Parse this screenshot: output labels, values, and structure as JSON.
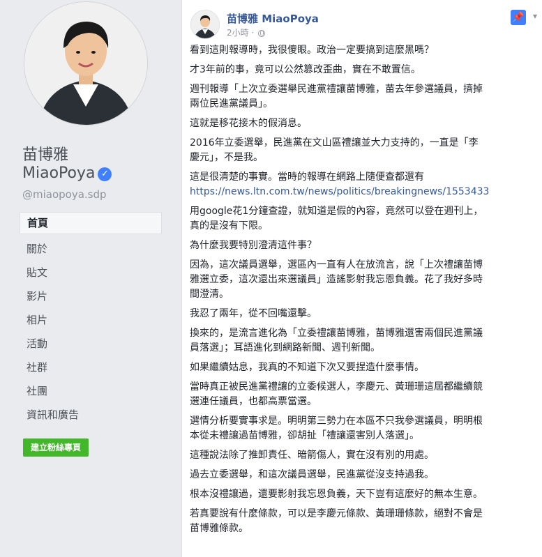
{
  "profile": {
    "name_line1": "苗博雅",
    "name_line2": "MiaoPoya",
    "handle": "@miaopoya.sdp"
  },
  "nav": {
    "items": [
      {
        "label": "首頁"
      },
      {
        "label": "關於"
      },
      {
        "label": "貼文"
      },
      {
        "label": "影片"
      },
      {
        "label": "相片"
      },
      {
        "label": "活動"
      },
      {
        "label": "社群"
      },
      {
        "label": "社團"
      },
      {
        "label": "資訊和廣告"
      }
    ]
  },
  "create_button": "建立粉絲專頁",
  "post": {
    "author": "苗博雅 MiaoPoya",
    "time": "2小時 · ",
    "paragraphs": [
      {
        "text": "看到這則報導時，我很傻眼。政治一定要搞到這麼黑嗎？"
      },
      {
        "text": "才3年前的事，竟可以公然篡改歪曲，實在不敢置信。"
      },
      {
        "text": "週刊報導「上次立委選舉民進黨禮讓苗博雅，苗去年參選議員，擠掉\n兩位民進黨議員」。"
      },
      {
        "text": "這就是移花接木的假消息。"
      },
      {
        "text": "2016年立委選舉，民進黨在文山區禮讓並大力支持的，一直是「李\n慶元」，不是我。"
      },
      {
        "text": "這是很清楚的事實。當時的報導在網路上隨便查都還有"
      },
      {
        "text": "用google花1分鐘查證，就知道是假的內容，竟然可以登在週刊上，\n真的是沒有下限。"
      },
      {
        "text": "為什麼我要特別澄清這件事？"
      },
      {
        "text": "因為，這次議員選舉，選區內一直有人在放流言，說「上次禮讓苗博\n雅選立委，這次還出來選議員」造謠影射我忘恩負義。花了我好多時\n間澄清。"
      },
      {
        "text": "我忍了兩年，從不回嘴還擊。"
      },
      {
        "text": "換來的，是流言進化為「立委禮讓苗博雅，苗博雅還害兩個民進黨議\n員落選」；耳語進化到網路新聞、週刊新聞。"
      },
      {
        "text": "如果繼續姑息，我真的不知道下次又要捏造什麼事情。"
      },
      {
        "text": "當時真正被民進黨禮讓的立委候選人，李慶元、黃珊珊這屆都繼續競\n選連任議員，也都高票當選。"
      },
      {
        "text": "選情分析要實事求是。明明第三勢力在本區不只我參選議員，明明根\n本從未禮讓過苗博雅，卻胡扯「禮讓還害別人落選」。"
      },
      {
        "text": "這種說法除了推卸責任、暗箭傷人，實在沒有別的用處。"
      },
      {
        "text": "過去立委選舉，和這次議員選舉，民進黨從沒支持過我。"
      },
      {
        "text": "根本沒禮讓過，還要影射我忘恩負義，天下豈有這麼好的無本生意。"
      },
      {
        "text": "若真要說有什麼條款，可以是李慶元條款、黃珊珊條款，絕對不會是\n苗博雅條款。"
      }
    ],
    "link": "https://news.ltn.com.tw/news/politics/breakingnews/1553433"
  },
  "colors": {
    "link": "#365899",
    "verified": "#4080ff",
    "button": "#42b72a"
  },
  "icons": {
    "verified": "verified-icon",
    "globe": "globe-icon",
    "pin": "pin-icon",
    "menu": "chevron-down-icon"
  }
}
